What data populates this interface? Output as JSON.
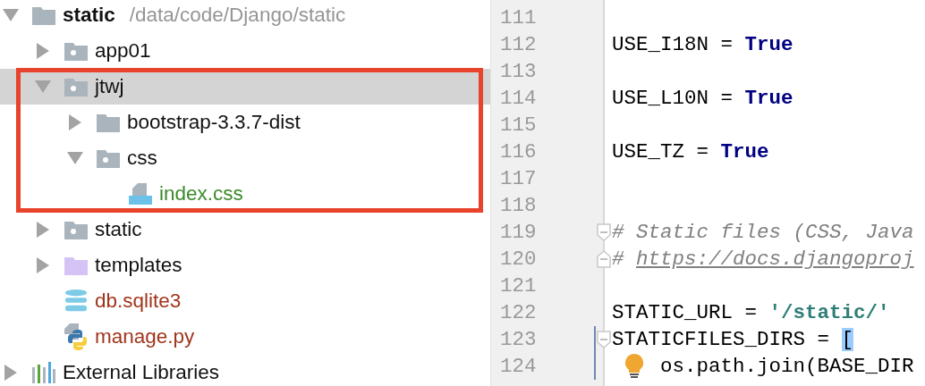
{
  "project_tree": {
    "items": [
      {
        "name": "static",
        "path": "/data/code/Django/static",
        "kind": "folder",
        "expanded": true,
        "selected": false,
        "highlighted": false,
        "children": [
          {
            "name": "app01",
            "kind": "package",
            "expanded": false,
            "selected": false,
            "highlighted": false
          },
          {
            "name": "jtwj",
            "kind": "package",
            "expanded": true,
            "selected": true,
            "highlighted": true,
            "children": [
              {
                "name": "bootstrap-3.3.7-dist",
                "kind": "folder",
                "expanded": false,
                "selected": false,
                "highlighted": false
              },
              {
                "name": "css",
                "kind": "package",
                "expanded": true,
                "selected": false,
                "highlighted": false,
                "children": [
                  {
                    "name": "index.css",
                    "kind": "css-file",
                    "selected": false,
                    "highlighted": false,
                    "color": "#3b8a2c"
                  }
                ]
              }
            ]
          },
          {
            "name": "static",
            "kind": "package",
            "expanded": false,
            "selected": false,
            "highlighted": false
          },
          {
            "name": "templates",
            "kind": "template-folder",
            "expanded": false,
            "selected": false,
            "highlighted": false
          },
          {
            "name": "db.sqlite3",
            "kind": "database-file",
            "selected": false,
            "highlighted": false,
            "color": "#a1361d"
          },
          {
            "name": "manage.py",
            "kind": "python-file",
            "selected": false,
            "highlighted": false,
            "color": "#a1361d"
          }
        ]
      },
      {
        "name": "External Libraries",
        "kind": "library",
        "expanded": false,
        "selected": false,
        "highlighted": false
      }
    ]
  },
  "editor": {
    "lines": [
      {
        "number": "111"
      },
      {
        "number": "112",
        "tokens": [
          {
            "kind": "plain",
            "text": "USE_I18N = "
          },
          {
            "kind": "keyword",
            "text": "True"
          }
        ]
      },
      {
        "number": "113"
      },
      {
        "number": "114",
        "tokens": [
          {
            "kind": "plain",
            "text": "USE_L10N = "
          },
          {
            "kind": "keyword",
            "text": "True"
          }
        ]
      },
      {
        "number": "115"
      },
      {
        "number": "116",
        "tokens": [
          {
            "kind": "plain",
            "text": "USE_TZ = "
          },
          {
            "kind": "keyword",
            "text": "True"
          }
        ]
      },
      {
        "number": "117"
      },
      {
        "number": "118"
      },
      {
        "number": "119",
        "fold_start": true,
        "tokens": [
          {
            "kind": "comment",
            "text": "# Static files (CSS, Java"
          }
        ]
      },
      {
        "number": "120",
        "fold_end": true,
        "tokens": [
          {
            "kind": "comment",
            "text": "# "
          },
          {
            "kind": "link",
            "text": "https://docs.djangoproj"
          }
        ]
      },
      {
        "number": "121"
      },
      {
        "number": "122",
        "tokens": [
          {
            "kind": "plain",
            "text": "STATIC_URL = "
          },
          {
            "kind": "string",
            "text": "'/static/'"
          }
        ]
      },
      {
        "number": "123",
        "fold_start": true,
        "changed": true,
        "tokens": [
          {
            "kind": "plain",
            "text": "STATICFILES_DIRS = "
          },
          {
            "kind": "bracket-match",
            "text": "["
          }
        ]
      },
      {
        "number": "124",
        "changed": true,
        "intention": true,
        "tokens": [
          {
            "kind": "plain",
            "text": "os.path.join(BASE_DIR"
          }
        ]
      }
    ]
  }
}
